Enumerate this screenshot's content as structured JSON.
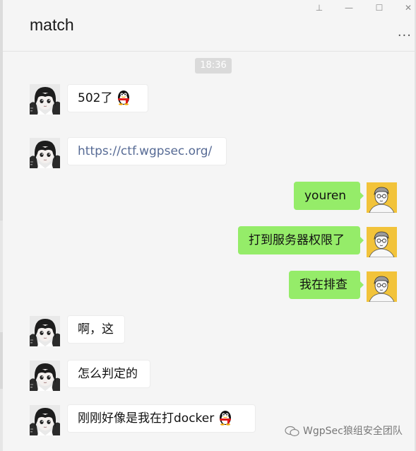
{
  "chat": {
    "title": "match",
    "more_label": "···"
  },
  "window_controls": {
    "pin": "⊥",
    "minimize": "—",
    "maximize": "☐",
    "close": "✕"
  },
  "timestamp": "18:36",
  "messages": [
    {
      "side": "in",
      "text": "502了",
      "emoji": "qq-penguin"
    },
    {
      "side": "in",
      "text": "https://ctf.wgpsec.org/",
      "is_link": true
    },
    {
      "side": "out",
      "text": "youren"
    },
    {
      "side": "out",
      "text": "打到服务器权限了"
    },
    {
      "side": "out",
      "text": "我在排查"
    },
    {
      "side": "in",
      "text": "啊，这"
    },
    {
      "side": "in",
      "text": "怎么判定的"
    },
    {
      "side": "in",
      "text": "刚刚好像是我在打docker",
      "emoji": "qq-penguin"
    }
  ],
  "watermark": "WgpSec狼组安全团队",
  "colors": {
    "outgoing_bubble": "#95ec69",
    "link": "#576b95",
    "background": "#f5f5f5"
  }
}
